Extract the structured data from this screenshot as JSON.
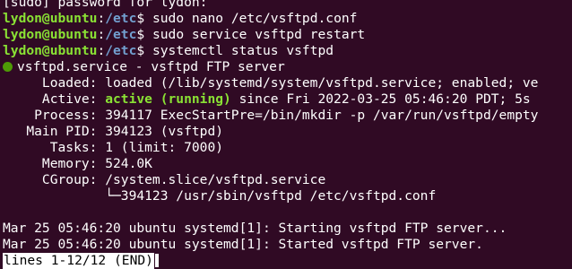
{
  "terminal": {
    "line0": "[sudo] password for lydon:",
    "prompt_user": "lydon@ubuntu",
    "prompt_path": "/etc",
    "prompt_symbol": "$",
    "cmd1": "sudo nano /etc/vsftpd.conf",
    "cmd2": "sudo service vsftpd restart",
    "cmd3": "systemctl status vsftpd",
    "service_header": "vsftpd.service - vsftpd FTP server",
    "loaded": "     Loaded: loaded (/lib/systemd/system/vsftpd.service; enabled; ve",
    "active_label": "     Active: ",
    "active_state": "active (running)",
    "active_rest": " since Fri 2022-03-25 05:46:20 PDT; 5s",
    "process": "    Process: 394117 ExecStartPre=/bin/mkdir -p /var/run/vsftpd/empty",
    "mainpid": "   Main PID: 394123 (vsftpd)",
    "tasks": "      Tasks: 1 (limit: 7000)",
    "memory": "     Memory: 524.0K",
    "cgroup": "     CGroup: /system.slice/vsftpd.service",
    "cgroup_child": "             └─394123 /usr/sbin/vsftpd /etc/vsftpd.conf",
    "log1": "Mar 25 05:46:20 ubuntu systemd[1]: Starting vsftpd FTP server...",
    "log2": "Mar 25 05:46:20 ubuntu systemd[1]: Started vsftpd FTP server.",
    "pager_status": "lines 1-12/12 (END)"
  },
  "colors": {
    "background": "#300a24",
    "prompt_user": "#8ae234",
    "prompt_path": "#729fcf",
    "status_active": "#8ae234",
    "status_dot": "#4e9a06"
  },
  "icons": {
    "status_dot": "active-status-dot-icon"
  }
}
